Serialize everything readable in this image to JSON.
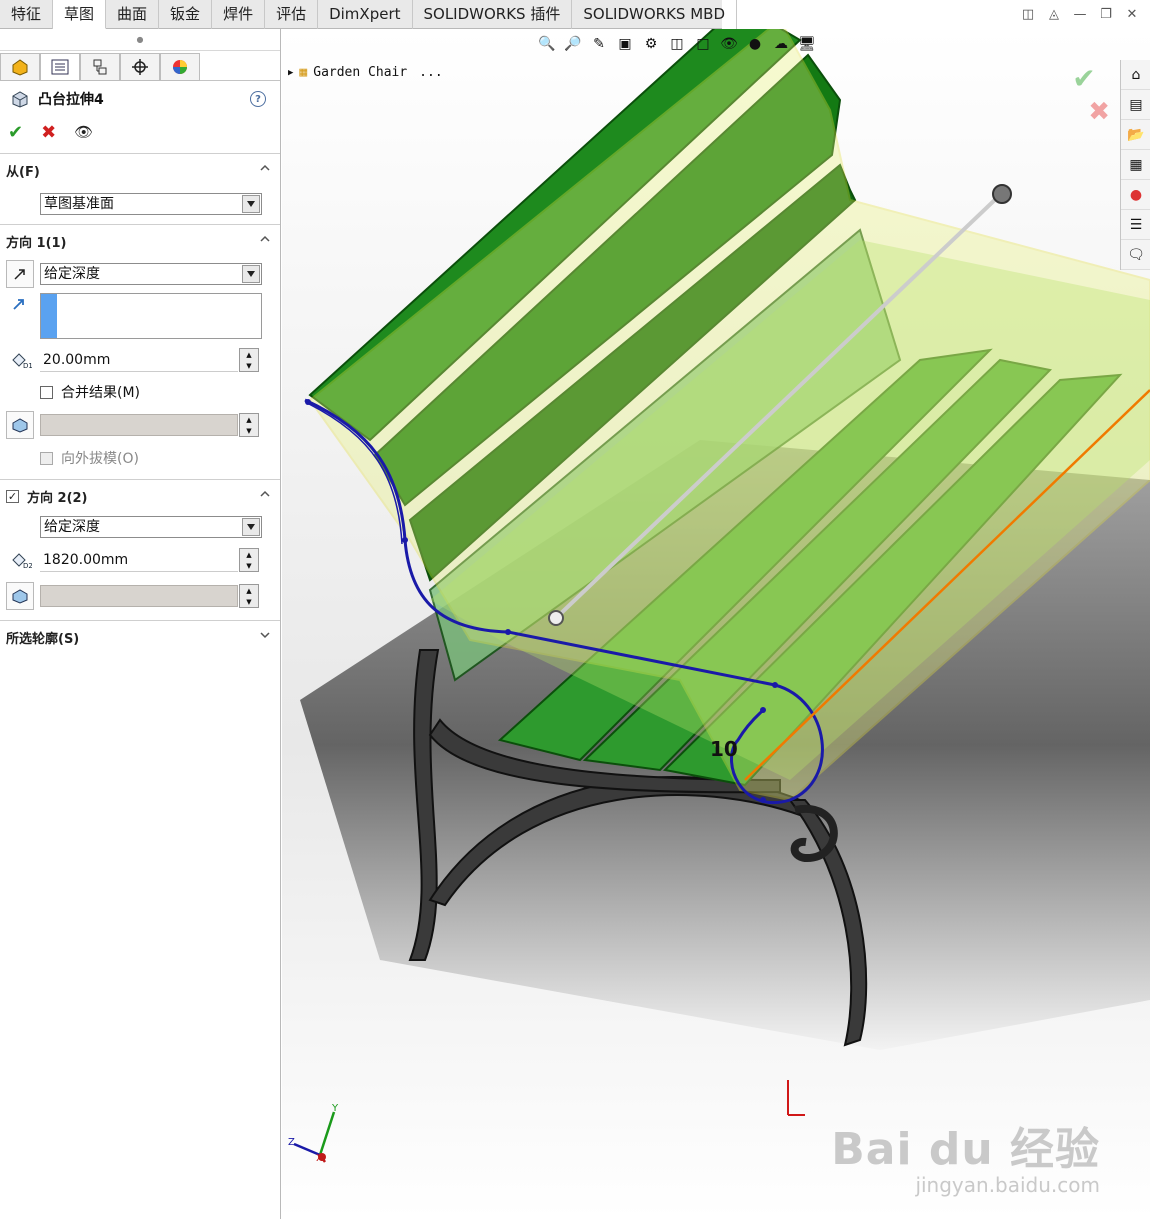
{
  "tabs": [
    "特征",
    "草图",
    "曲面",
    "钣金",
    "焊件",
    "评估",
    "DimXpert",
    "SOLIDWORKS 插件",
    "SOLIDWORKS MBD"
  ],
  "active_tab": 1,
  "panel": {
    "feature_title": "凸台拉伸4",
    "from": {
      "header": "从(F)",
      "start_condition": "草图基准面"
    },
    "direction1": {
      "header": "方向 1(1)",
      "end_condition": "给定深度",
      "depth": "20.00mm",
      "merge_label": "合并结果(M)",
      "draft_label": "向外拔模(O)"
    },
    "direction2": {
      "header": "方向 2(2)",
      "end_condition": "给定深度",
      "depth": "1820.00mm"
    },
    "selected_contours": {
      "header": "所选轮廓(S)"
    }
  },
  "viewport": {
    "tree_root": "Garden Chair",
    "tree_more": "...",
    "dimension_label": "10",
    "watermark_main": "Bai du 经验",
    "watermark_sub": "jingyan.baidu.com"
  },
  "colors": {
    "accent_green": "#2a9b2a",
    "cancel_red": "#d02020",
    "slat_green": "#1d8a1d",
    "sketch_blue": "#1a1aa8"
  }
}
